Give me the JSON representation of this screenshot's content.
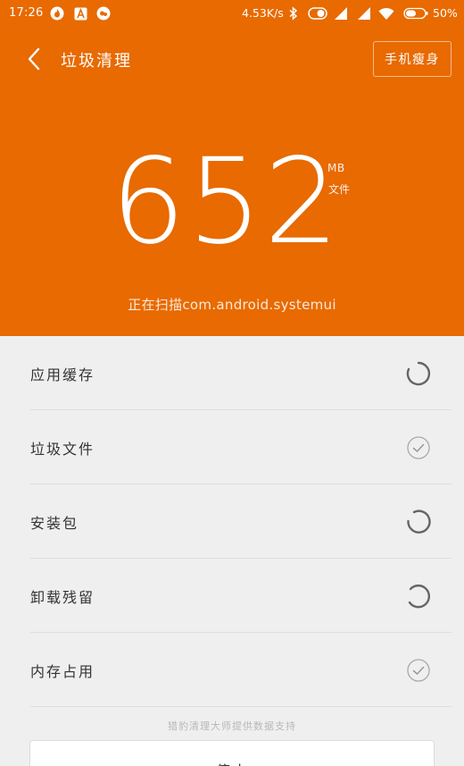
{
  "status_bar": {
    "time": "17:26",
    "network_speed": "4.53K/s",
    "battery": "50%",
    "icons": [
      "flame-notification-icon",
      "a-notification-icon",
      "chat-notification-icon",
      "bluetooth-icon",
      "toggle-icon",
      "signal-icon",
      "signal-icon",
      "wifi-icon",
      "battery-icon"
    ]
  },
  "header": {
    "back_icon": "chevron-left-icon",
    "title": "垃圾清理",
    "slim_button": "手机瘦身"
  },
  "scan": {
    "size_value": "652",
    "size_unit": "MB",
    "size_label": "文件",
    "status_text": "正在扫描com.android.systemui"
  },
  "categories": [
    {
      "label": "应用缓存",
      "state": "scanning"
    },
    {
      "label": "垃圾文件",
      "state": "done"
    },
    {
      "label": "安装包",
      "state": "scanning"
    },
    {
      "label": "卸载残留",
      "state": "scanning"
    },
    {
      "label": "内存占用",
      "state": "done"
    }
  ],
  "footer": {
    "powered_by": "猎豹清理大师提供数据支持",
    "stop_button": "停止"
  },
  "colors": {
    "accent": "#e86a00",
    "background": "#efefef",
    "text": "#333333"
  }
}
